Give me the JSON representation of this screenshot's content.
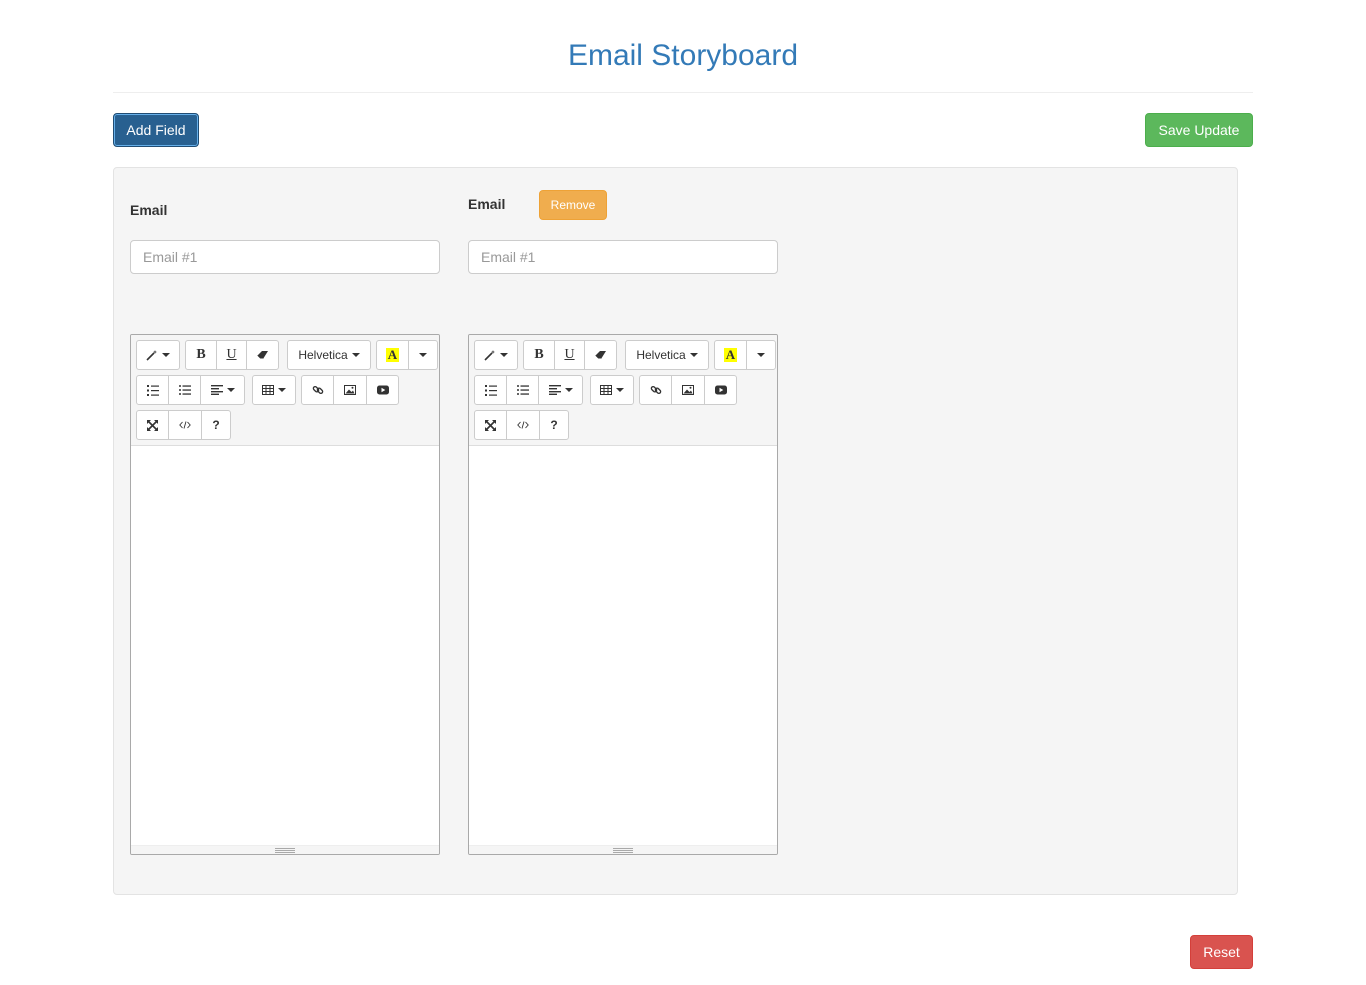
{
  "page": {
    "title": "Email Storyboard"
  },
  "actions": {
    "add_field_label": "Add Field",
    "save_update_label": "Save Update",
    "reset_label": "Reset"
  },
  "fields": [
    {
      "label": "Email",
      "placeholder": "Email #1",
      "value": "",
      "toolbar": {
        "font_name": "Helvetica",
        "bold": "B",
        "underline": "U",
        "highlight": "A",
        "help": "?"
      }
    },
    {
      "label": "Email",
      "remove_label": "Remove",
      "placeholder": "Email #1",
      "value": "",
      "toolbar": {
        "font_name": "Helvetica",
        "bold": "B",
        "underline": "U",
        "highlight": "A",
        "help": "?"
      }
    }
  ],
  "colors": {
    "title": "#337ab7",
    "add_field": "#286090",
    "save_update": "#5cb85c",
    "remove": "#f0ad4e",
    "reset": "#d9534f",
    "highlight": "#ffff00"
  }
}
